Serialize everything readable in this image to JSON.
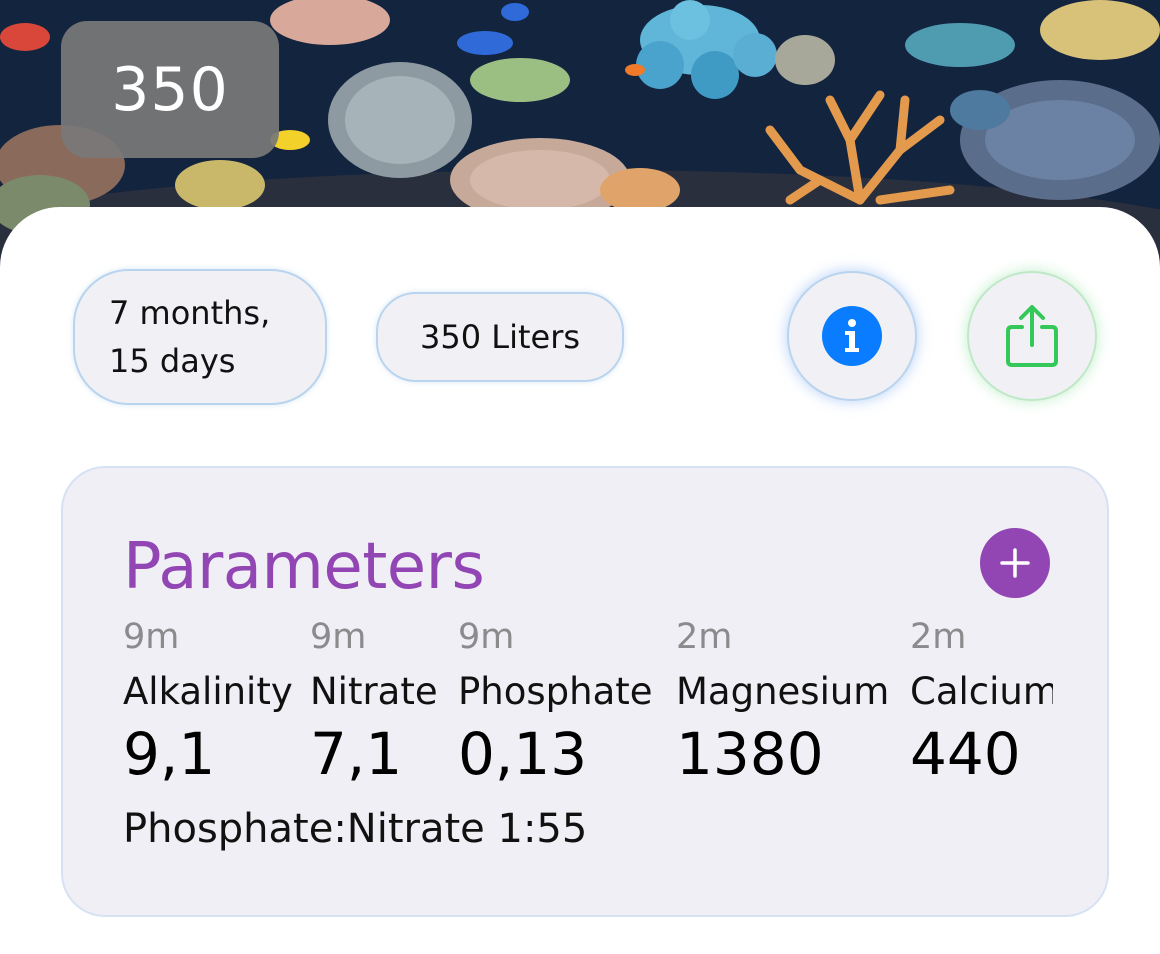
{
  "tank": {
    "volume_badge": "350",
    "age": "7 months, 15 days",
    "volume": "350 Liters"
  },
  "header_actions": {
    "info_icon": "info-circle-icon",
    "share_icon": "share-icon"
  },
  "parameters": {
    "title": "Parameters",
    "add_icon": "plus-icon",
    "items": [
      {
        "age": "9m",
        "name": "Alkalinity",
        "value": "9,1"
      },
      {
        "age": "9m",
        "name": "Nitrate",
        "value": "7,1"
      },
      {
        "age": "9m",
        "name": "Phosphate",
        "value": "0,13"
      },
      {
        "age": "2m",
        "name": "Magnesium",
        "value": "1380"
      },
      {
        "age": "2m",
        "name": "Calcium",
        "value": "440"
      }
    ],
    "ratio": "Phosphate:Nitrate 1:55"
  },
  "colors": {
    "accent_purple": "#9146b4",
    "info_blue": "#0a7cff",
    "share_green": "#34c759",
    "card_background": "#f0eff5"
  }
}
